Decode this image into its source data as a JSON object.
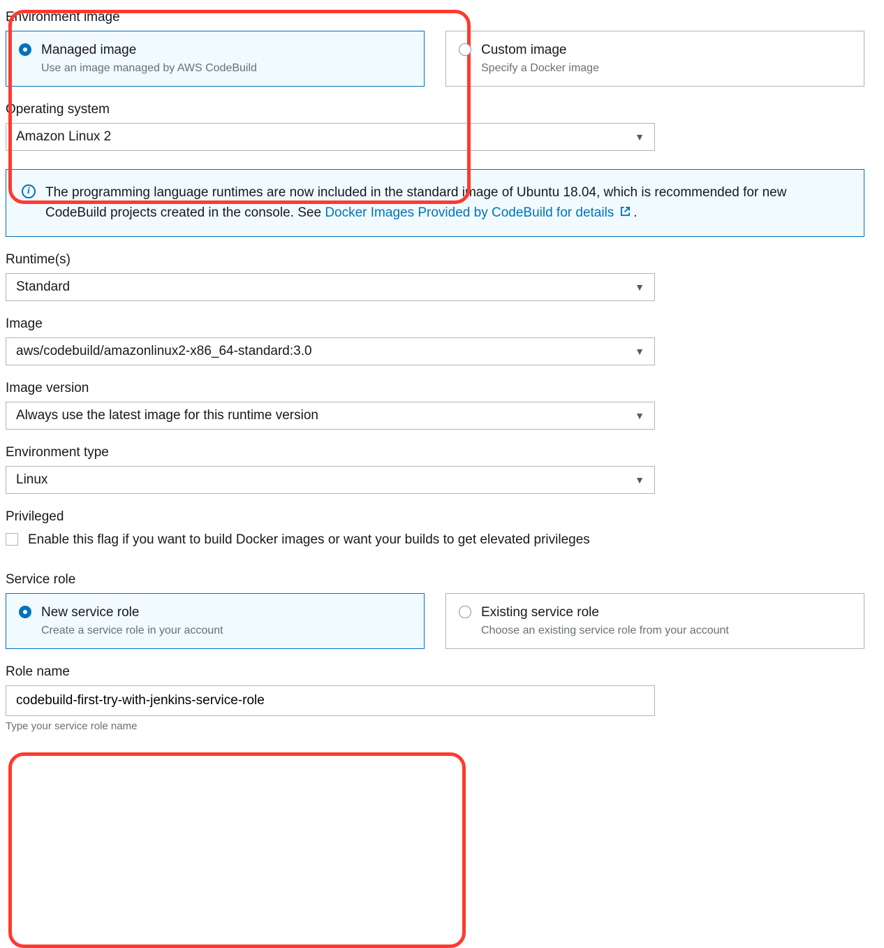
{
  "env_image": {
    "label": "Environment image",
    "managed": {
      "title": "Managed image",
      "desc": "Use an image managed by AWS CodeBuild"
    },
    "custom": {
      "title": "Custom image",
      "desc": "Specify a Docker image"
    }
  },
  "os": {
    "label": "Operating system",
    "value": "Amazon Linux 2"
  },
  "info": {
    "text_a": "The programming language runtimes are now included in the standard image of Ubuntu 18.04, which is recommended for new CodeBuild projects created in the console. See ",
    "link": "Docker Images Provided by CodeBuild for details",
    "after": "."
  },
  "runtime": {
    "label": "Runtime(s)",
    "value": "Standard"
  },
  "image": {
    "label": "Image",
    "value": "aws/codebuild/amazonlinux2-x86_64-standard:3.0"
  },
  "image_version": {
    "label": "Image version",
    "value": "Always use the latest image for this runtime version"
  },
  "env_type": {
    "label": "Environment type",
    "value": "Linux"
  },
  "privileged": {
    "label": "Privileged",
    "text": "Enable this flag if you want to build Docker images or want your builds to get elevated privileges"
  },
  "service_role": {
    "label": "Service role",
    "new": {
      "title": "New service role",
      "desc": "Create a service role in your account"
    },
    "existing": {
      "title": "Existing service role",
      "desc": "Choose an existing service role from your account"
    }
  },
  "role_name": {
    "label": "Role name",
    "value": "codebuild-first-try-with-jenkins-service-role",
    "helper": "Type your service role name"
  }
}
